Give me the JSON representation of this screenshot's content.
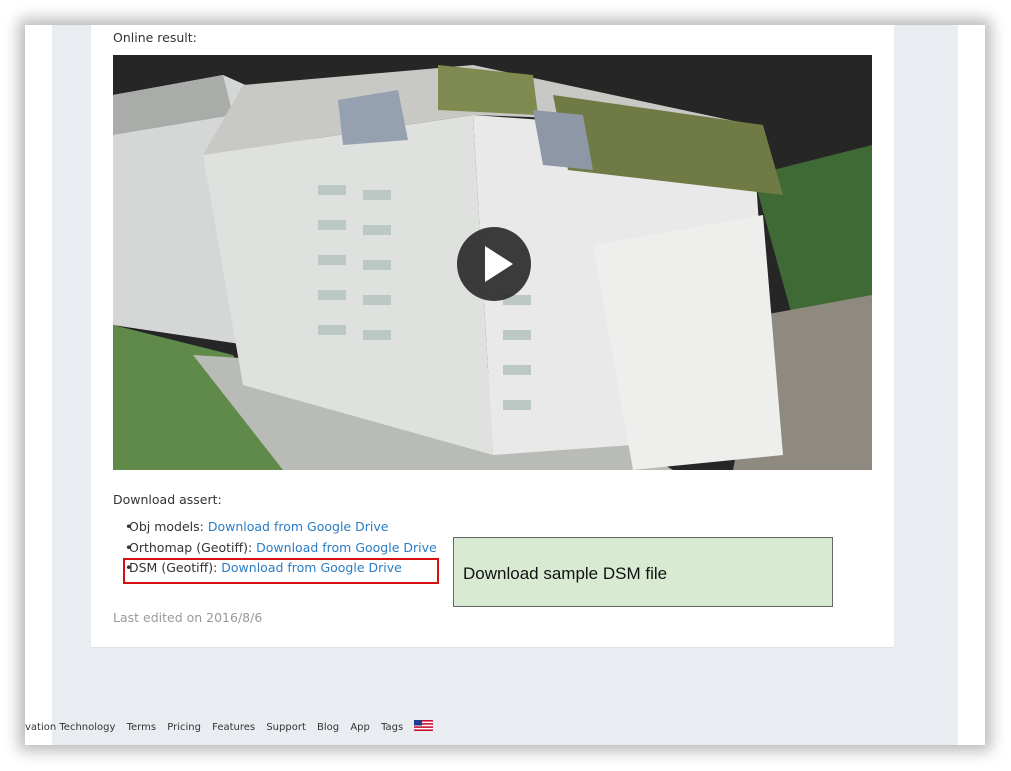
{
  "content": {
    "online_result_label": "Online result:",
    "download_label": "Download assert:",
    "assets": [
      {
        "name": "Obj models:",
        "link": "Download from Google Drive"
      },
      {
        "name": "Orthomap (Geotiff):",
        "link": "Download from Google Drive"
      },
      {
        "name": "DSM (Geotiff):",
        "link": "Download from Google Drive"
      }
    ],
    "last_edited": "Last edited on 2016/8/6"
  },
  "video": {
    "icon": "play-icon"
  },
  "annotation": {
    "note_text": "Download sample DSM file",
    "highlight_color": "#d51010",
    "note_bg": "#d9ead3"
  },
  "footer": {
    "items": [
      "vation Technology",
      "Terms",
      "Pricing",
      "Features",
      "Support",
      "Blog",
      "App",
      "Tags"
    ],
    "flag_icon": "us-flag-icon"
  },
  "colors": {
    "link": "#2a7cc3",
    "page_bg": "#e9edf2"
  }
}
